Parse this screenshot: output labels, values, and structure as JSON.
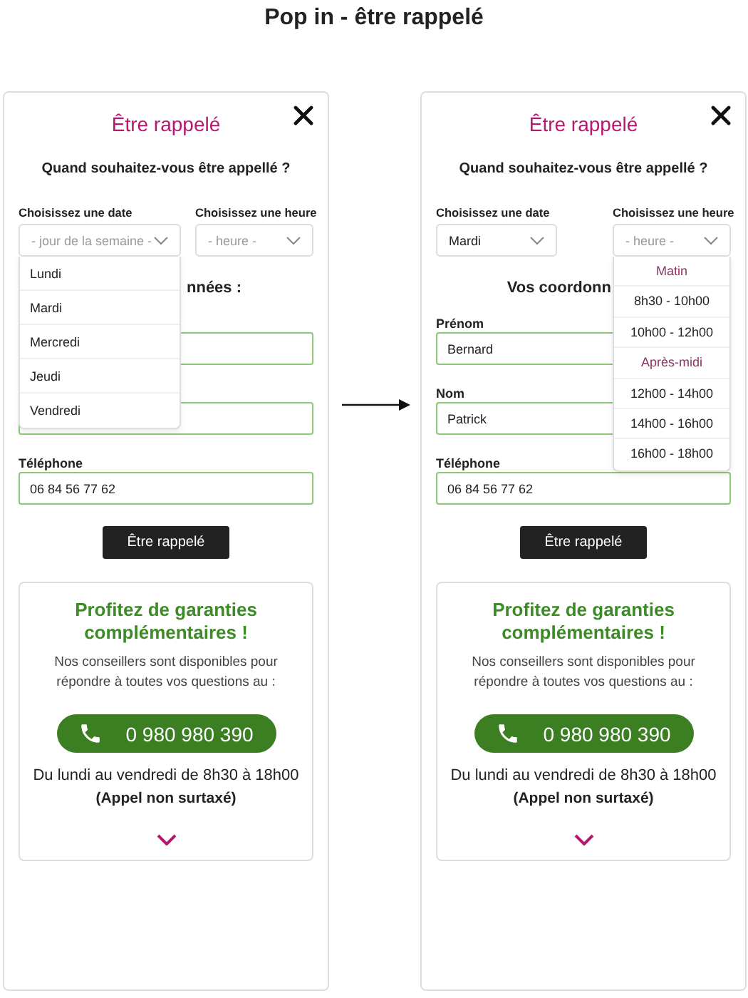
{
  "page_title": "Pop in - être rappelé",
  "panels": [
    {
      "title": "Être rappelé",
      "question": "Quand souhaitez-vous être appellé ?",
      "selects": [
        {
          "label": "Choisissez une date",
          "placeholder": "- jour de la semaine -",
          "open": true,
          "options": [
            {
              "kind": "option",
              "text": "Lundi"
            },
            {
              "kind": "option",
              "text": "Mardi"
            },
            {
              "kind": "option",
              "text": "Mercredi"
            },
            {
              "kind": "option",
              "text": "Jeudi"
            },
            {
              "kind": "option",
              "text": "Vendredi"
            }
          ]
        },
        {
          "label": "Choisissez une heure",
          "placeholder": "- heure -",
          "open": false
        }
      ],
      "contact_heading": "nnées :",
      "fields": [
        {
          "valid": true
        },
        {
          "valid": true
        },
        {
          "label": "Téléphone",
          "value": "06 84 56 77 62",
          "valid": true
        }
      ],
      "submit": "Être rappelé",
      "promo": {
        "title": "Profitez de garanties complémentaires !",
        "text": "Nos conseillers sont disponibles pour répondre à toutes vos questions au :",
        "phone": "0 980 980 390",
        "hours": "Du lundi au vendredi de 8h30 à 18h00",
        "note": "(Appel non surtaxé)"
      }
    },
    {
      "title": "Être rappelé",
      "question": "Quand souhaitez-vous être appellé ?",
      "selects": [
        {
          "label": "Choisissez une date",
          "value": "Mardi",
          "open": false
        },
        {
          "label": "Choisissez une heure",
          "placeholder": "- heure -",
          "open": true,
          "options": [
            {
              "kind": "group",
              "text": "Matin"
            },
            {
              "kind": "option",
              "text": "8h30 - 10h00"
            },
            {
              "kind": "option",
              "text": "10h00 - 12h00"
            },
            {
              "kind": "group",
              "text": "Après-midi"
            },
            {
              "kind": "option",
              "text": "12h00 - 14h00"
            },
            {
              "kind": "option",
              "text": "14h00 - 16h00"
            },
            {
              "kind": "option",
              "text": "16h00 - 18h00"
            }
          ]
        }
      ],
      "contact_heading": "Vos coordonn",
      "fields": [
        {
          "label": "Prénom",
          "value": "Bernard",
          "valid": true
        },
        {
          "label": "Nom",
          "value": "Patrick",
          "valid": true
        },
        {
          "label": "Téléphone",
          "value": "06 84 56 77 62",
          "valid": true
        }
      ],
      "submit": "Être rappelé",
      "promo": {
        "title": "Profitez de garanties complémentaires !",
        "text": "Nos conseillers sont disponibles pour répondre à toutes vos questions au :",
        "phone": "0 980 980 390",
        "hours": "Du lundi au vendredi de 8h30 à 18h00",
        "note": "(Appel non surtaxé)"
      }
    }
  ]
}
